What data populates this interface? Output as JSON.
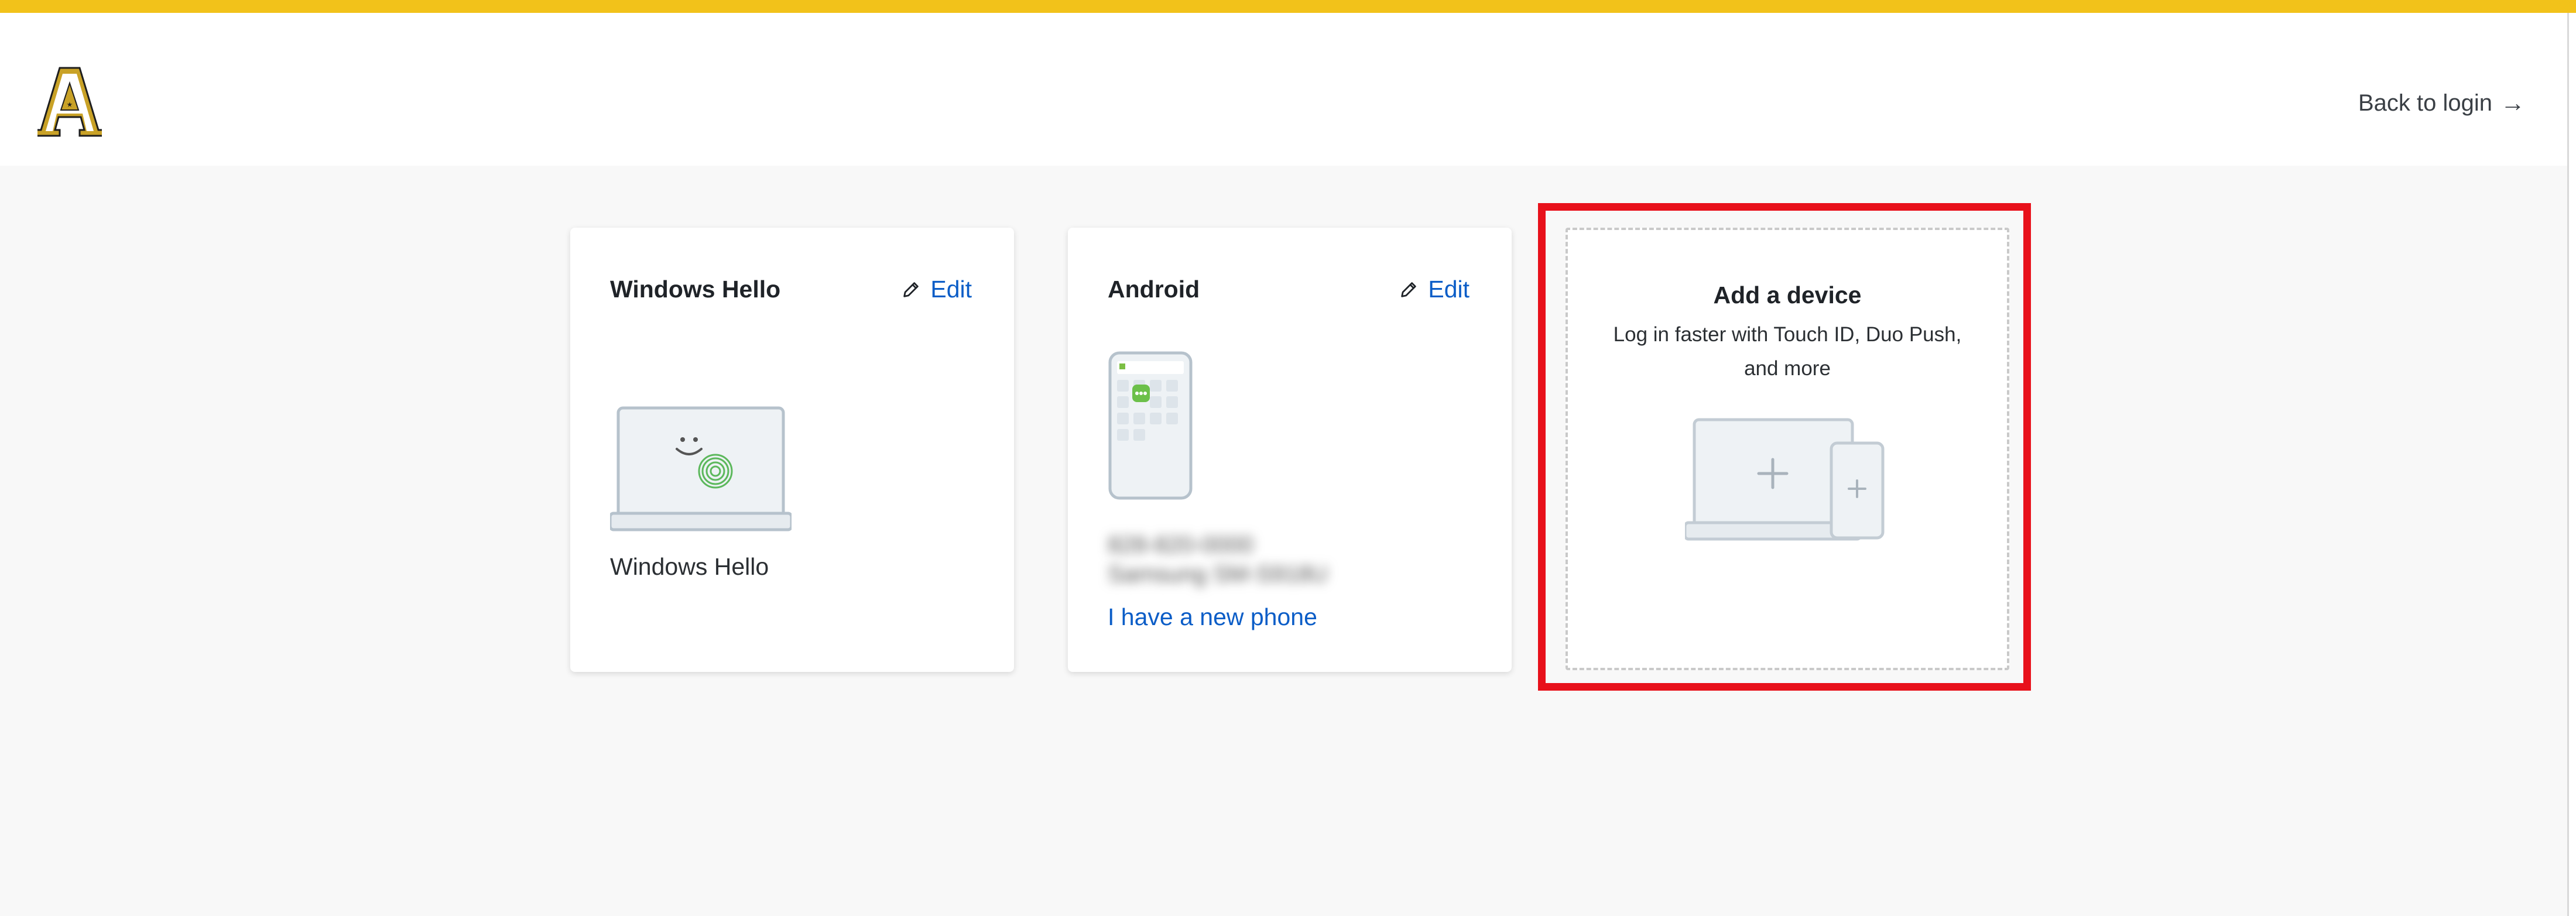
{
  "header": {
    "logo_icon": "collegiate-letter-a-logo",
    "back_link_label": "Back to login",
    "back_link_arrow": "→"
  },
  "colors": {
    "accent_bar": "#f2c21a",
    "link": "#0b5dc7",
    "highlight": "#e8111b"
  },
  "devices": [
    {
      "title": "Windows Hello",
      "edit_label": "Edit",
      "edit_icon": "pencil-icon",
      "illustration_icon": "laptop-fingerprint-icon",
      "device_name": "Windows Hello"
    },
    {
      "title": "Android",
      "edit_label": "Edit",
      "edit_icon": "pencil-icon",
      "illustration_icon": "phone-duo-app-icon",
      "blurred_line_1": "828-820-0000",
      "blurred_line_2": "Samsung SM-S918U",
      "new_phone_label": "I have a new phone"
    }
  ],
  "add_device": {
    "title": "Add a device",
    "subtitle": "Log in faster with Touch ID, Duo Push, and more",
    "illustration_icon": "laptop-phone-plus-icon"
  }
}
